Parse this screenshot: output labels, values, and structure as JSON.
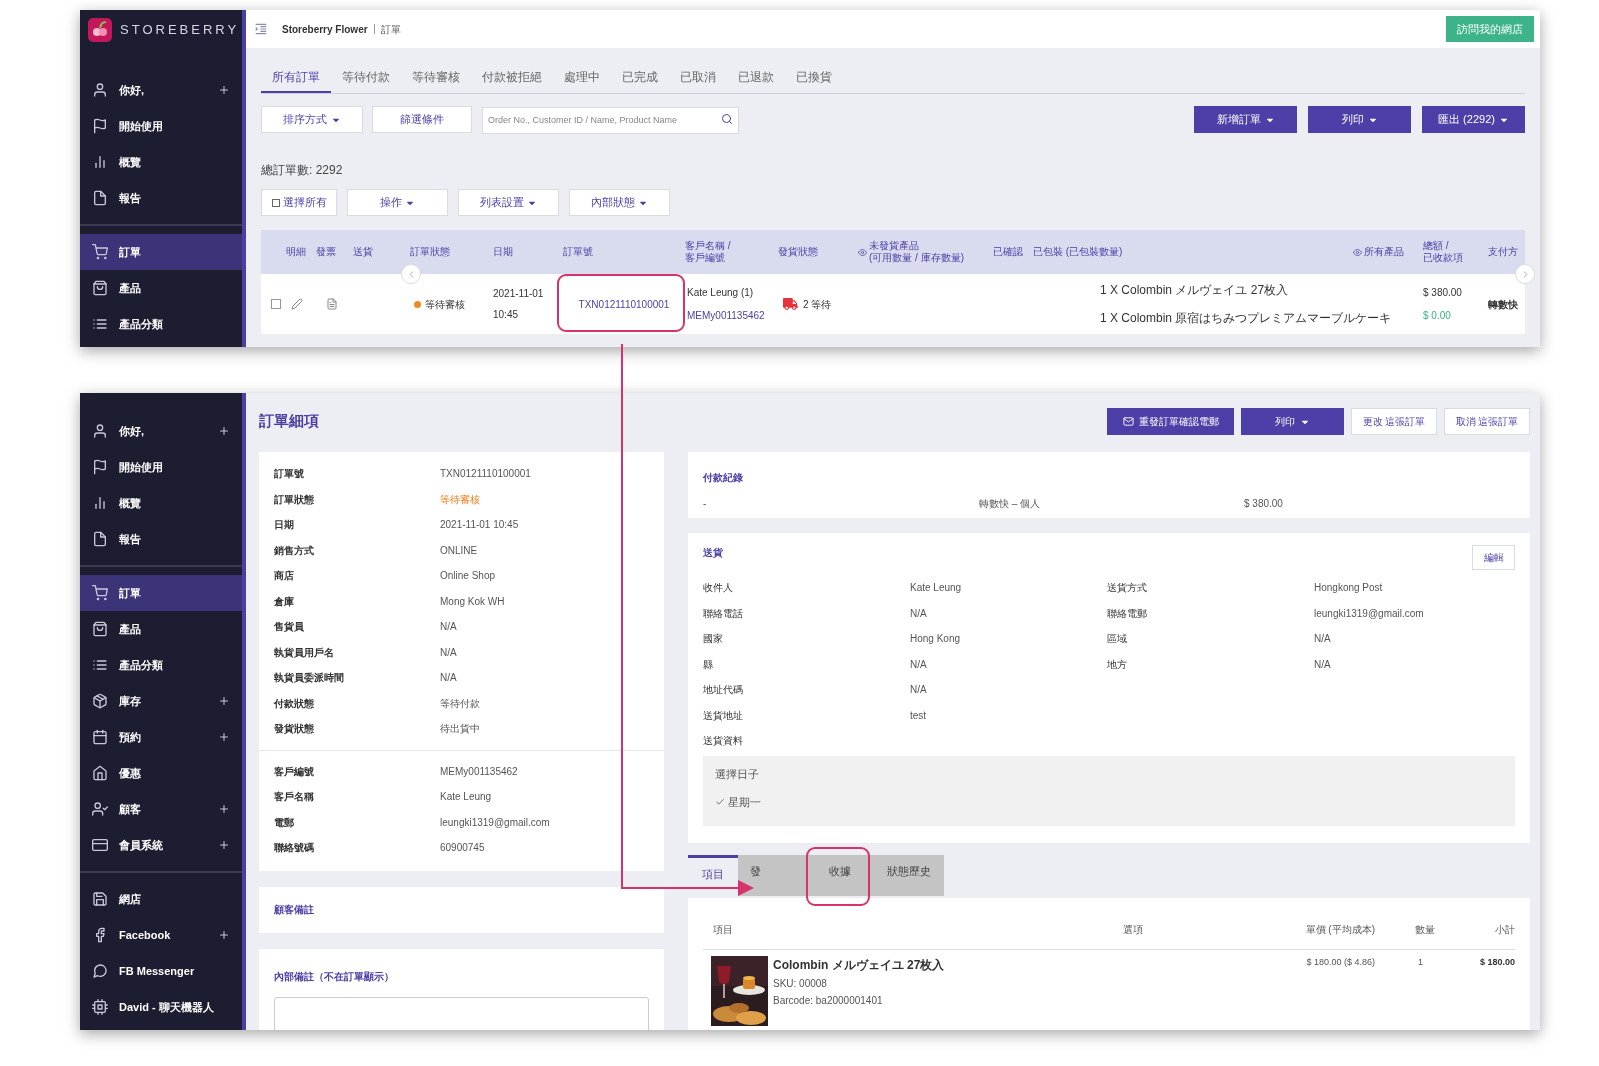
{
  "top_screenshot": {
    "brand": "STOREBERRY",
    "sidebar_groups": [
      [
        {
          "label": "你好,",
          "expandable": true,
          "selected": false
        },
        {
          "label": "開始使用",
          "expandable": false,
          "selected": false
        },
        {
          "label": "概覽",
          "expandable": false,
          "selected": false
        },
        {
          "label": "報告",
          "expandable": false,
          "selected": false
        }
      ],
      [
        {
          "label": "訂單",
          "expandable": false,
          "selected": true
        },
        {
          "label": "產品",
          "expandable": false,
          "selected": false
        },
        {
          "label": "產品分類",
          "expandable": false,
          "selected": false
        }
      ]
    ],
    "breadcrumb": [
      "Storeberry Flower",
      "訂單"
    ],
    "visit_store_button": "訪問我的網店",
    "tabs": [
      {
        "label": "所有訂單",
        "selected": true
      },
      {
        "label": "等待付款",
        "selected": false
      },
      {
        "label": "等待審核",
        "selected": false
      },
      {
        "label": "付款被拒絕",
        "selected": false
      },
      {
        "label": "處理中",
        "selected": false
      },
      {
        "label": "已完成",
        "selected": false
      },
      {
        "label": "已取消",
        "selected": false
      },
      {
        "label": "已退款",
        "selected": false
      },
      {
        "label": "已換貨",
        "selected": false
      }
    ],
    "sort_button": "排序方式",
    "filter_button": "篩選條件",
    "search": {
      "placeholder": "Order No., Customer ID / Name, Product Name"
    },
    "action_buttons": [
      "新增訂單",
      "列印",
      "匯出 (2292)"
    ],
    "total_orders": "總訂單數: 2292",
    "bulk_buttons": [
      {
        "label": "選擇所有",
        "kind": "checkbox",
        "checked": false
      },
      {
        "label": "操作",
        "kind": "dropdown"
      },
      {
        "label": "列表設置",
        "kind": "dropdown"
      },
      {
        "label": "內部狀態",
        "kind": "dropdown"
      }
    ],
    "table": {
      "columns": [
        {
          "label": "明細"
        },
        {
          "label": "發票"
        },
        {
          "label": "送貨"
        },
        {
          "label": "訂單狀態"
        },
        {
          "label": "日期"
        },
        {
          "label": "訂單號"
        },
        {
          "label": "客戶名稱 / 客戶編號"
        },
        {
          "label": "發貨狀態"
        },
        {
          "label": "未發貨產品",
          "sub": "(可用數量 / 庫存數量)",
          "eye": true
        },
        {
          "label": "已確認"
        },
        {
          "label": "已包裝 (已包裝數量)"
        },
        {
          "label": "所有產品",
          "eye": true
        },
        {
          "label": "總額 / 已收款項"
        },
        {
          "label": "支付方"
        }
      ],
      "rows": [
        {
          "checked": false,
          "status": "等待審核",
          "color": "#f28a22",
          "date": "2021-11-01",
          "time": "10:45",
          "order_no": "TXN0121110100001",
          "highlighted": true,
          "customer": "Kate Leung (1)",
          "customer_id": "MEMy001135462",
          "shipping": "2 等待",
          "products": [
            "1 X Colombin メルヴェイユ 27枚入",
            "1 X Colombin 原宿はちみつプレミアムマーブルケーキ"
          ],
          "total": "$ 380.00",
          "received": "$ 0.00",
          "payment": "轉數快"
        }
      ]
    }
  },
  "bottom_screenshot": {
    "sidebar_groups": [
      [
        {
          "label": "你好,",
          "expandable": true,
          "selected": false
        },
        {
          "label": "開始使用",
          "expandable": false,
          "selected": false
        },
        {
          "label": "概覽",
          "expandable": false,
          "selected": false
        },
        {
          "label": "報告",
          "expandable": false,
          "selected": false
        }
      ],
      [
        {
          "label": "訂單",
          "expandable": false,
          "selected": true
        },
        {
          "label": "產品",
          "expandable": false,
          "selected": false
        },
        {
          "label": "產品分類",
          "expandable": false,
          "selected": false
        },
        {
          "label": "庫存",
          "expandable": true,
          "selected": false
        },
        {
          "label": "預約",
          "expandable": true,
          "selected": false
        },
        {
          "label": "優惠",
          "expandable": false,
          "selected": false
        },
        {
          "label": "顧客",
          "expandable": true,
          "selected": false
        },
        {
          "label": "會員系統",
          "expandable": true,
          "selected": false
        }
      ],
      [
        {
          "label": "網店",
          "expandable": false,
          "selected": false
        },
        {
          "label": "Facebook",
          "expandable": true,
          "selected": false
        },
        {
          "label": "FB Messenger",
          "expandable": false,
          "selected": false
        },
        {
          "label": "David - 聊天機器人",
          "expandable": false,
          "selected": false
        }
      ]
    ],
    "title": "訂單細項",
    "header_buttons": [
      {
        "label": "重發訂單確認電郵",
        "kind": "mail"
      },
      {
        "label": "列印",
        "kind": "dropdown"
      },
      {
        "label": "更改 這張訂單",
        "kind": "outline"
      },
      {
        "label": "取消 這張訂單",
        "kind": "outline"
      }
    ],
    "order_info": [
      {
        "label": "訂單號",
        "value": "TXN0121110100001"
      },
      {
        "label": "訂單狀態",
        "value": "等待審核",
        "kind": "status"
      },
      {
        "label": "日期",
        "value": "2021-11-01 10:45"
      },
      {
        "label": "銷售方式",
        "value": "ONLINE"
      },
      {
        "label": "商店",
        "value": "Online Shop"
      },
      {
        "label": "倉庫",
        "value": "Mong Kok WH"
      },
      {
        "label": "售貨員",
        "value": "N/A"
      },
      {
        "label": "執貨員用戶名",
        "value": "N/A"
      },
      {
        "label": "執貨員委派時間",
        "value": "N/A"
      },
      {
        "label": "付款狀態",
        "value": "等待付款"
      },
      {
        "label": "發貨狀態",
        "value": "待出貨中"
      }
    ],
    "customer_info": [
      {
        "label": "客戶編號",
        "value": "MEMy001135462"
      },
      {
        "label": "客戶名稱",
        "value": "Kate Leung"
      },
      {
        "label": "電郵",
        "value": "leungki1319@gmail.com"
      },
      {
        "label": "聯絡號碼",
        "value": "60900745"
      }
    ],
    "customer_note": {
      "title": "顧客備註"
    },
    "internal_note": {
      "title": "內部備註（不在訂單顯示）"
    },
    "payment_record": {
      "title": "付款紀錄",
      "column_1": "-",
      "method": "轉數快 – 個人",
      "amount": "$ 380.00"
    },
    "shipping": {
      "title": "送貨",
      "edit_button": "編輯",
      "left": [
        {
          "label": "收件人",
          "value": "Kate Leung"
        },
        {
          "label": "聯絡電話",
          "value": "N/A"
        },
        {
          "label": "國家",
          "value": "Hong Kong"
        },
        {
          "label": "縣",
          "value": "N/A"
        },
        {
          "label": "地址代碼",
          "value": "N/A"
        },
        {
          "label": "送貨地址",
          "value": "test"
        },
        {
          "label": "送貨資料"
        }
      ],
      "right": [
        {
          "label": "送貨方式",
          "value": "Hongkong Post"
        },
        {
          "label": "聯絡電郵",
          "value": "leungki1319@gmail.com"
        },
        {
          "label": "區域",
          "value": "N/A"
        },
        {
          "label": "地方",
          "value": "N/A"
        }
      ],
      "delivery_day": {
        "label": "選擇日子",
        "option": "星期一",
        "checked": true
      }
    },
    "detail_tabs": [
      {
        "label": "項目",
        "selected": true,
        "highlighted": false
      },
      {
        "label": "發",
        "selected": false,
        "highlighted": false
      },
      {
        "label": "收據",
        "selected": false,
        "highlighted": true
      },
      {
        "label": "狀態歷史",
        "selected": false,
        "highlighted": false
      }
    ],
    "items_table": {
      "columns": [
        "項目",
        "選項",
        "單價 (平均成本)",
        "數量",
        "小計"
      ],
      "rows": [
        {
          "name": "Colombin メルヴェイユ 27枚入",
          "sku": "SKU: 00008",
          "barcode": "Barcode: ba2000001401",
          "price": "$ 180.00 ($ 4.86)",
          "quantity": "1",
          "subtotal": "$ 180.00"
        }
      ]
    }
  }
}
